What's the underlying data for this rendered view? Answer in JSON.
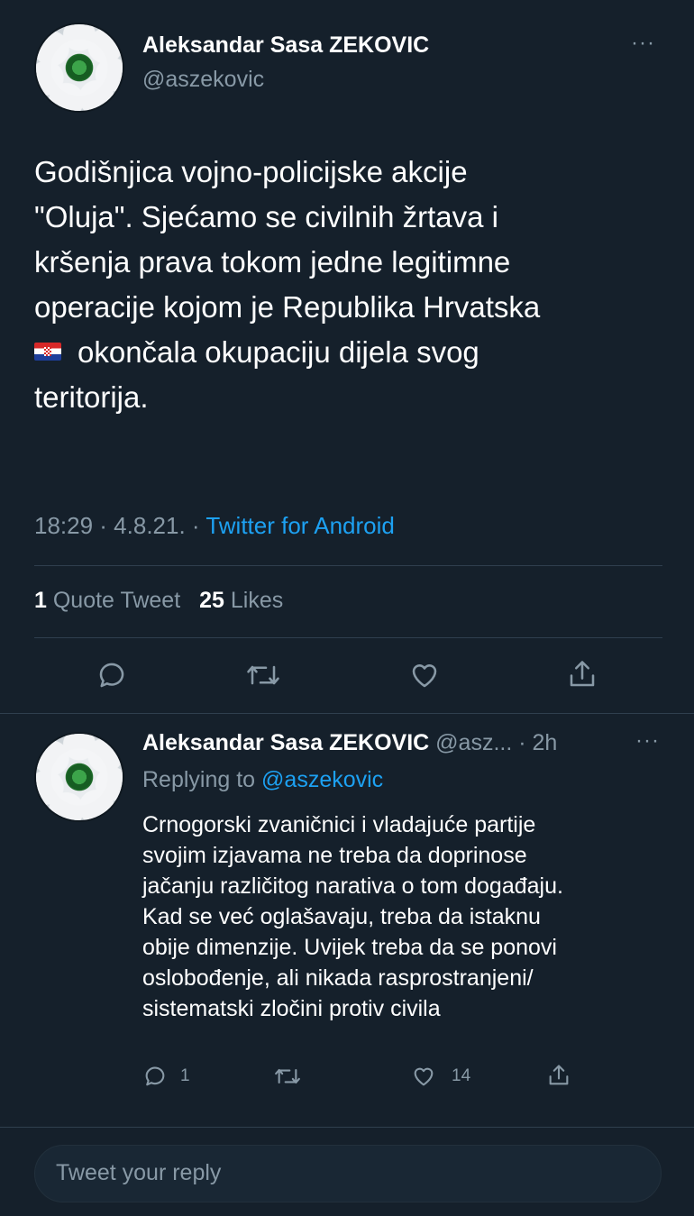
{
  "main_tweet": {
    "display_name": "Aleksandar Sasa ZEKOVIC",
    "handle": "@aszekovic",
    "text_lines": [
      "Godišnjica vojno-policijske akcije",
      "\"Oluja\". Sjećamo se civilnih žrtava i",
      "kršenja prava tokom jedne legitimne",
      "operacije kojom je Republika Hrvatska",
      "okončala okupaciju dijela svog",
      "teritorija."
    ],
    "time": "18:29 · 4.8.21. · ",
    "source": "Twitter for Android",
    "quote_count": "1",
    "quote_label": "Quote Tweet",
    "like_count": "25",
    "like_label": "Likes"
  },
  "reply_tweet": {
    "display_name": "Aleksandar Sasa ZEKOVIC",
    "handle_time": "@asz... · 2h",
    "replying_prefix": "Replying to ",
    "replying_handle": "@aszekovic",
    "text_lines": [
      "Crnogorski zvaničnici i vladajuće partije",
      "svojim izjavama ne treba da doprinose",
      "jačanju različitog narativa o tom događaju.",
      "Kad se već oglašavaju, treba da istaknu",
      "obije dimenzije. Uvijek treba da se ponovi",
      "oslobođenje, ali nikada rasprostranjeni/",
      "sistematski zločini protiv civila"
    ],
    "reply_count": "1",
    "like_count": "14"
  },
  "more_label": "···",
  "compose": {
    "placeholder": "Tweet your reply"
  },
  "icons": {
    "reply": "comment-icon",
    "retweet": "retweet-icon",
    "like": "heart-icon",
    "share": "share-icon"
  },
  "colors": {
    "background": "#15202b",
    "accent": "#1da1f2",
    "muted": "#8899a6"
  }
}
